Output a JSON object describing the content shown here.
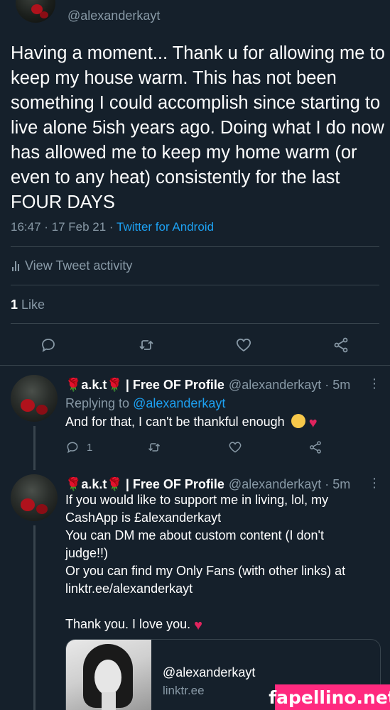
{
  "main_tweet": {
    "handle": "@alexanderkayt",
    "text": "Having a moment... Thank u for allowing me to keep my house warm. This has not been something I could accomplish since starting to live alone 5ish years ago. Doing what I do now has allowed me to keep my home warm (or even to any heat) consistently for the last FOUR DAYS",
    "timestamp": "16:47 · 17 Feb 21 · ",
    "source": "Twitter for Android",
    "activity_label": "View Tweet activity",
    "like_count": "1",
    "like_label": " Like",
    "actions": [
      "reply-icon",
      "retweet-icon",
      "like-icon",
      "share-icon"
    ]
  },
  "replies": [
    {
      "name_prefix": "🌹a.k.t🌹",
      "name": "| Free OF Profile",
      "handle": "@alexanderkayt · 5m",
      "replying_label": "Replying to ",
      "replying_handle": "@alexanderkayt",
      "text": "And for that, I can't be thankful enough",
      "reply_count": "1",
      "more": "⋮"
    },
    {
      "name_prefix": "🌹a.k.t🌹",
      "name": "| Free OF Profile",
      "handle": "@alexanderkayt · 5m",
      "line1": "If you would like to support me in living, lol, my",
      "line2": "CashApp is £alexanderkayt",
      "line3": "You can DM me about custom content (I don't",
      "line4": "judge!!)",
      "line5": "Or you can find my Only Fans (with other links) at",
      "link": "linktr.ee/alexanderkayt",
      "line7": "Thank you. I love you.",
      "more": "⋮",
      "card": {
        "title": "@alexanderkayt",
        "domain": "linktr.ee"
      }
    }
  ],
  "watermark": "fapellino.net",
  "colors": {
    "background": "#15202b",
    "text": "#ffffff",
    "muted": "#8899a6",
    "link": "#1da1f2",
    "divider": "#38444d"
  }
}
